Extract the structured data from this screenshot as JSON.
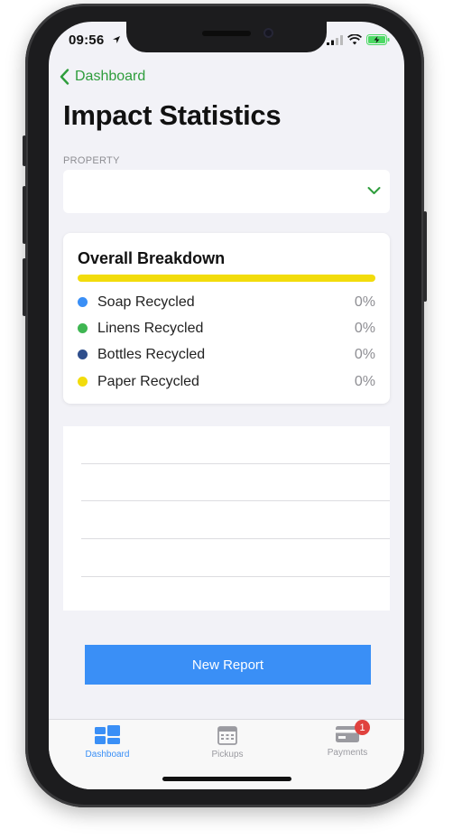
{
  "status_bar": {
    "time": "09:56"
  },
  "nav": {
    "back_label": "Dashboard"
  },
  "page": {
    "title": "Impact Statistics"
  },
  "property": {
    "label": "PROPERTY",
    "value": ""
  },
  "breakdown": {
    "title": "Overall Breakdown",
    "bar_color": "#f2dc0c",
    "items": [
      {
        "label": "Soap Recycled",
        "percent": "0%",
        "color": "#3a8ff6"
      },
      {
        "label": "Linens Recycled",
        "percent": "0%",
        "color": "#3fb652"
      },
      {
        "label": "Bottles Recycled",
        "percent": "0%",
        "color": "#2f4f8c"
      },
      {
        "label": "Paper Recycled",
        "percent": "0%",
        "color": "#f2dc0c"
      }
    ]
  },
  "actions": {
    "new_report_label": "New Report"
  },
  "tab_bar": {
    "tabs": [
      {
        "label": "Dashboard",
        "icon": "dashboard-icon",
        "active": true
      },
      {
        "label": "Pickups",
        "icon": "calendar-icon",
        "active": false
      },
      {
        "label": "Payments",
        "icon": "credit-card-icon",
        "active": false,
        "badge": "1"
      }
    ]
  },
  "colors": {
    "accent": "#2e9d3c",
    "primary_button": "#3a8ff6",
    "tab_active": "#3a8ff6",
    "tab_inactive": "#9a9aa0"
  }
}
